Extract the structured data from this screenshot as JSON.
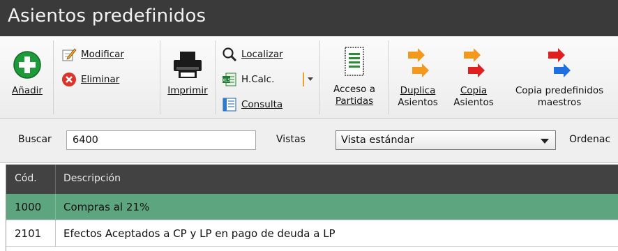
{
  "window": {
    "title": "Asientos predefinidos"
  },
  "toolbar": {
    "add_label": "Añadir",
    "modify_label": "Modificar",
    "delete_label": "Eliminar",
    "print_label": "Imprimir",
    "locate_label": "Localizar",
    "hcalc_label": "H.Calc.",
    "query_label": "Consulta",
    "access_label_line1": "Acceso a",
    "access_label_line2": "Partidas",
    "duplicate_label_line1": "Duplica",
    "duplicate_label_line2": "Asientos",
    "copy_label_line1": "Copia",
    "copy_label_line2": "Asientos",
    "copy_master_label_line1": "Copia predefinidos",
    "copy_master_label_line2": "maestros"
  },
  "filters": {
    "search_label": "Buscar",
    "search_value": "6400",
    "views_label": "Vistas",
    "views_value": "Vista estándar",
    "order_label": "Ordenac"
  },
  "table": {
    "columns": [
      "Cód.",
      "Descripción"
    ],
    "rows": [
      {
        "code": "1000",
        "description": "Compras al 21%",
        "selected": true
      },
      {
        "code": "2101",
        "description": "Efectos Aceptados a CP y LP en pago de deuda a LP",
        "selected": false
      }
    ]
  },
  "colors": {
    "titlebar": "#3a3a3a",
    "header": "#424242",
    "selected_row": "#5da57e",
    "arrow_orange": "#f39a1e",
    "arrow_red": "#e01f1f",
    "arrow_blue": "#1f6fe0",
    "add_green": "#1e9a3a",
    "delete_red": "#d9352b"
  },
  "icons": [
    "add-icon",
    "edit-icon",
    "delete-icon",
    "printer-icon",
    "search-icon",
    "spreadsheet-icon",
    "query-icon",
    "document-lines-icon",
    "duplicate-arrows-icon",
    "copy-arrows-icon",
    "copy-master-arrows-icon"
  ]
}
